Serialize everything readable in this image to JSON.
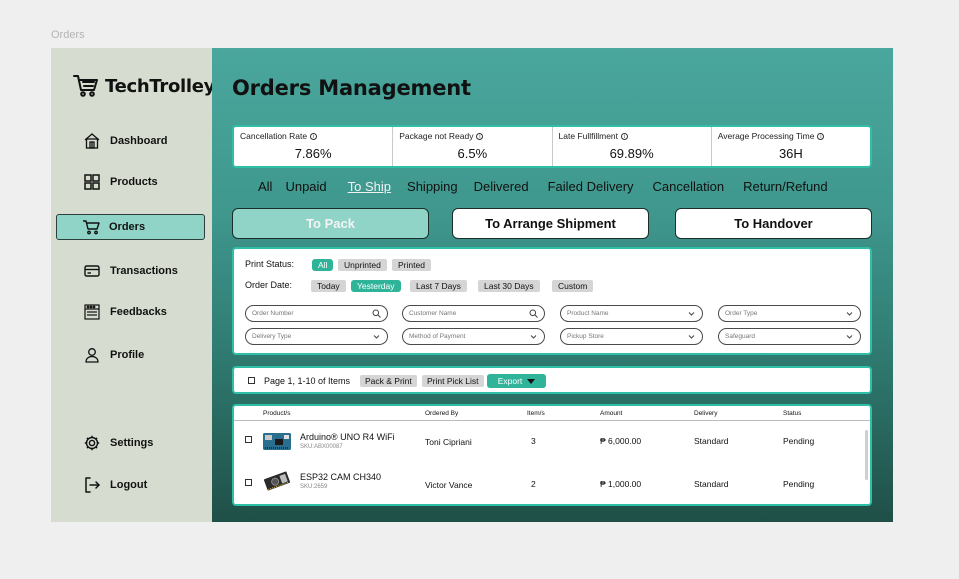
{
  "frame": {
    "label": "Orders"
  },
  "brand": {
    "name": "TechTrolley"
  },
  "sidebar": {
    "items": [
      {
        "label": "Dashboard"
      },
      {
        "label": "Products"
      },
      {
        "label": "Orders"
      },
      {
        "label": "Transactions"
      },
      {
        "label": "Feedbacks"
      },
      {
        "label": "Profile"
      },
      {
        "label": "Settings"
      },
      {
        "label": "Logout"
      }
    ],
    "active": "Orders"
  },
  "page": {
    "title": "Orders Management"
  },
  "kpis": [
    {
      "label": "Cancellation Rate",
      "value": "7.86%"
    },
    {
      "label": "Package not Ready",
      "value": "6.5%"
    },
    {
      "label": "Late Fullfillment",
      "value": "69.89%"
    },
    {
      "label": "Average Processing Time",
      "value": "36H"
    }
  ],
  "status_tabs": [
    "All",
    "Unpaid",
    "To Ship",
    "Shipping",
    "Delivered",
    "Failed Delivery",
    "Cancellation",
    "Return/Refund"
  ],
  "status_tab_active": "To Ship",
  "sub_tabs": [
    "To Pack",
    "To Arrange Shipment",
    "To Handover"
  ],
  "sub_tab_active": "To Pack",
  "filters": {
    "print_status_label": "Print Status:",
    "print_status_options": [
      "All",
      "Unprinted",
      "Printed"
    ],
    "print_status_selected": "All",
    "order_date_label": "Order Date:",
    "order_date_options": [
      "Today",
      "Yesterday",
      "Last 7 Days",
      "Last 30 Days",
      "Custom"
    ],
    "order_date_selected": "Yesterday",
    "fields": [
      {
        "placeholder": "Order Number",
        "icon": "search-icon"
      },
      {
        "placeholder": "Customer Name",
        "icon": "search-icon"
      },
      {
        "placeholder": "Product Name",
        "icon": "chevron-down-icon"
      },
      {
        "placeholder": "Order Type",
        "icon": "chevron-down-icon"
      },
      {
        "placeholder": "Delivery Type",
        "icon": "chevron-down-icon"
      },
      {
        "placeholder": "Method of Payment",
        "icon": "chevron-down-icon"
      },
      {
        "placeholder": "Pickup Store",
        "icon": "chevron-down-icon"
      },
      {
        "placeholder": "Safeguard",
        "icon": "chevron-down-icon"
      }
    ]
  },
  "actions": {
    "page_info": "Page 1, 1-10 of Items",
    "pack_print": "Pack & Print",
    "print_pick_list": "Print Pick List",
    "export": "Export"
  },
  "table": {
    "headers": [
      "Product/s",
      "Ordered By",
      "Item/s",
      "Amount",
      "Delivery",
      "Status"
    ],
    "rows": [
      {
        "product": "Arduino® UNO R4 WiFi",
        "sku": "SKU:ABX00087",
        "ordered_by": "Toni Cipriani",
        "items": "3",
        "amount": "₱ 6,000.00",
        "delivery": "Standard",
        "status": "Pending"
      },
      {
        "product": "ESP32 CAM CH340",
        "sku": "SKU:2659",
        "ordered_by": "Victor Vance",
        "items": "2",
        "amount": "₱ 1,000.00",
        "delivery": "Standard",
        "status": "Pending"
      }
    ]
  },
  "colors": {
    "sidebar_bg": "#d6dcd0",
    "accent": "#2fb49a",
    "active_nav": "#8fd4c7",
    "main_gradient_top": "#4aa79d",
    "main_gradient_bottom": "#1f4f47"
  }
}
